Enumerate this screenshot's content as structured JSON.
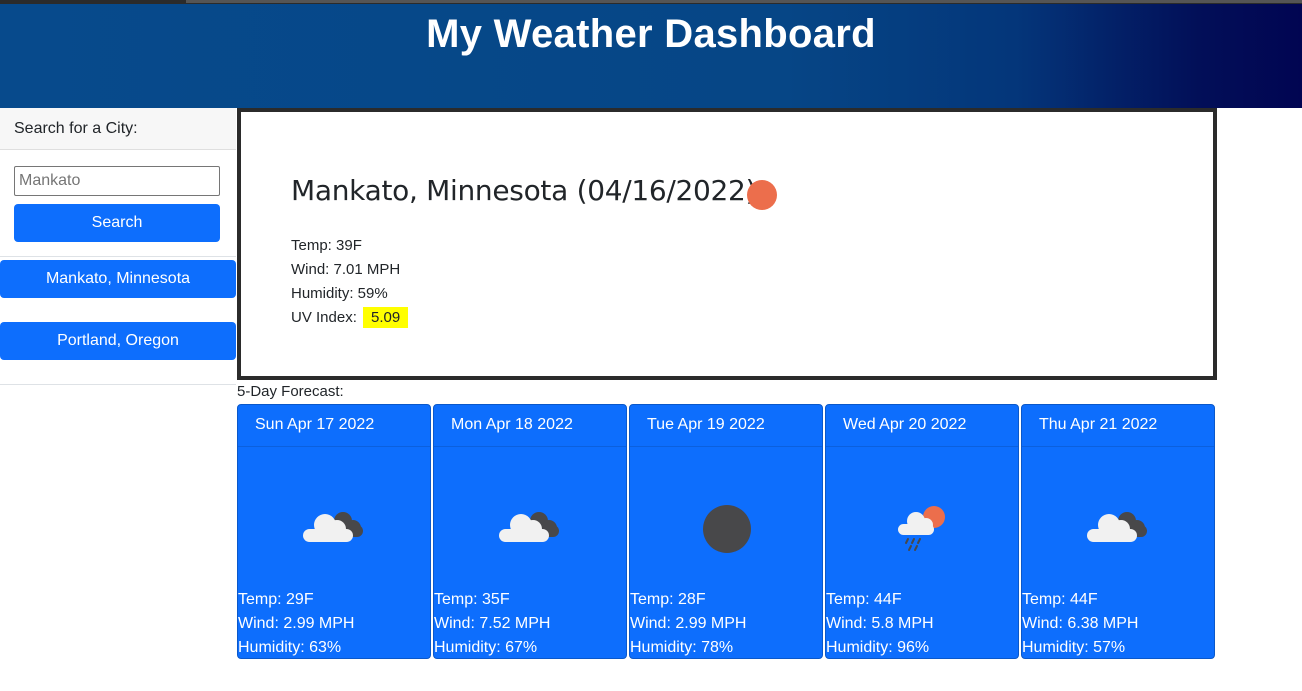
{
  "app": {
    "title": "My Weather Dashboard"
  },
  "search": {
    "header": "Search for a City:",
    "input_value": "Mankato",
    "button_label": "Search",
    "history": [
      "Mankato, Minnesota",
      "Portland, Oregon"
    ]
  },
  "current": {
    "title": "Mankato, Minnesota (04/16/2022)",
    "icon": "sun-icon",
    "temp": "Temp: 39F",
    "wind": "Wind: 7.01 MPH",
    "humidity": "Humidity: 59%",
    "uv_label": "UV Index:",
    "uv_value": "5.09",
    "uv_color": "#ffff00"
  },
  "forecast": {
    "label": "5-Day Forecast:",
    "days": [
      {
        "date": "Sun Apr 17 2022",
        "icon": "broken-clouds-icon",
        "temp": "Temp: 29F",
        "wind": "Wind: 2.99 MPH",
        "humidity": "Humidity: 63%"
      },
      {
        "date": "Mon Apr 18 2022",
        "icon": "broken-clouds-icon",
        "temp": "Temp: 35F",
        "wind": "Wind: 7.52 MPH",
        "humidity": "Humidity: 67%"
      },
      {
        "date": "Tue Apr 19 2022",
        "icon": "night-clear-icon",
        "temp": "Temp: 28F",
        "wind": "Wind: 2.99 MPH",
        "humidity": "Humidity: 78%"
      },
      {
        "date": "Wed Apr 20 2022",
        "icon": "rain-sun-icon",
        "temp": "Temp: 44F",
        "wind": "Wind: 5.8 MPH",
        "humidity": "Humidity: 96%"
      },
      {
        "date": "Thu Apr 21 2022",
        "icon": "broken-clouds-icon",
        "temp": "Temp: 44F",
        "wind": "Wind: 6.38 MPH",
        "humidity": "Humidity: 57%"
      }
    ]
  },
  "colors": {
    "header_start": "#074a8c",
    "header_end": "#010552",
    "accent": "#0d6efd",
    "sun": "#ec6e4c",
    "dark_cloud": "#48484a"
  }
}
